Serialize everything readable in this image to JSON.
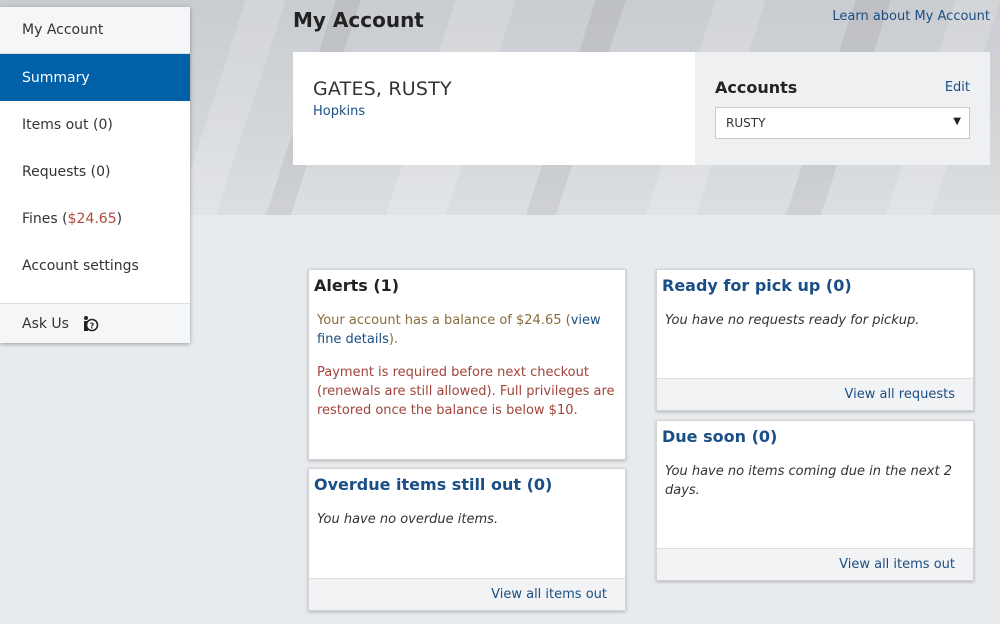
{
  "header": {
    "title": "My Account",
    "learn_link": "Learn about My Account"
  },
  "sidebar": {
    "heading": "My Account",
    "items": [
      {
        "label": "Summary"
      },
      {
        "label": "Items out (0)"
      },
      {
        "label": "Requests (0)"
      },
      {
        "label_prefix": "Fines (",
        "amount": "$24.65",
        "label_suffix": ")"
      },
      {
        "label": "Account settings"
      }
    ],
    "ask_us": "Ask Us"
  },
  "user": {
    "name": "GATES, RUSTY",
    "location": "Hopkins"
  },
  "accounts": {
    "label": "Accounts",
    "edit": "Edit",
    "selected": "RUSTY"
  },
  "alerts": {
    "title": "Alerts (1)",
    "balance_text": "Your account has a balance of $24.65 (",
    "balance_link": "view fine details",
    "balance_end": ").",
    "payment_text": "Payment is required before next checkout (renewals are still allowed). Full privileges are restored once the balance is below $10."
  },
  "overdue": {
    "title": "Overdue items still out (0)",
    "empty": "You have no overdue items.",
    "footer": "View all items out"
  },
  "pickup": {
    "title": "Ready for pick up (0)",
    "empty": "You have no requests ready for pickup.",
    "footer": "View all requests"
  },
  "due_soon": {
    "title": "Due soon (0)",
    "empty": "You have no items coming due in the next 2 days.",
    "footer": "View all items out"
  },
  "colors": {
    "accent": "#0060a8",
    "link": "#1a4e86",
    "warning": "#a0443a"
  }
}
